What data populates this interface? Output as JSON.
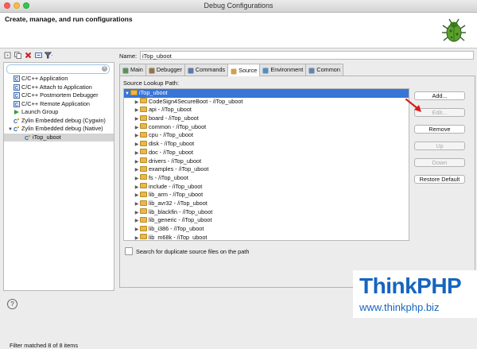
{
  "window": {
    "title": "Debug Configurations"
  },
  "header": {
    "title": "Create, manage, and run configurations"
  },
  "toolbar": {
    "icons": [
      "new-launch-config-icon",
      "duplicate-icon",
      "delete-icon",
      "collapse-all-icon",
      "filter-icon"
    ]
  },
  "left": {
    "filter_placeholder": "",
    "items": [
      {
        "label": "C/C++ Application",
        "icon": "c-app-icon",
        "level": 1
      },
      {
        "label": "C/C++ Attach to Application",
        "icon": "c-attach-icon",
        "level": 1
      },
      {
        "label": "C/C++ Postmortem Debugger",
        "icon": "c-postmortem-icon",
        "level": 1
      },
      {
        "label": "C/C++ Remote Application",
        "icon": "c-remote-icon",
        "level": 1
      },
      {
        "label": "Launch Group",
        "icon": "launch-group-icon",
        "level": 1
      },
      {
        "label": "Zylin Embedded debug (Cygwin)",
        "icon": "zylin-icon",
        "level": 1
      },
      {
        "label": "Zylin Embedded debug (Native)",
        "icon": "zylin-icon",
        "level": 1,
        "expanded": true
      },
      {
        "label": "iTop_uboot",
        "icon": "zylin-config-icon",
        "level": 2,
        "selected": true
      }
    ],
    "status": "Filter matched 8 of 8 items"
  },
  "right": {
    "name_label": "Name:",
    "name_value": "iTop_uboot",
    "tabs": [
      {
        "label": "Main",
        "icon": "main-tab-icon"
      },
      {
        "label": "Debugger",
        "icon": "debugger-tab-icon"
      },
      {
        "label": "Commands",
        "icon": "commands-tab-icon"
      },
      {
        "label": "Source",
        "icon": "source-tab-icon",
        "active": true
      },
      {
        "label": "Environment",
        "icon": "environment-tab-icon"
      },
      {
        "label": "Common",
        "icon": "common-tab-icon"
      }
    ],
    "source_label": "Source Lookup Path:",
    "source_root": "iTop_uboot",
    "source_items": [
      "CodeSign4SecureBoot - /iTop_uboot",
      "api - /iTop_uboot",
      "board - /iTop_uboot",
      "common - /iTop_uboot",
      "cpu - /iTop_uboot",
      "disk - /iTop_uboot",
      "doc - /iTop_uboot",
      "drivers - /iTop_uboot",
      "examples - /iTop_uboot",
      "fs - /iTop_uboot",
      "include - /iTop_uboot",
      "lib_arm - /iTop_uboot",
      "lib_avr32 - /iTop_uboot",
      "lib_blackfin - /iTop_uboot",
      "lib_generic - /iTop_uboot",
      "lib_i386 - /iTop_uboot",
      "lib_m68k - /iTop_uboot"
    ],
    "buttons": [
      {
        "label": "Add...",
        "enabled": true
      },
      {
        "label": "Edit...",
        "enabled": false
      },
      {
        "label": "Remove",
        "enabled": true
      },
      {
        "label": "Up",
        "enabled": false
      },
      {
        "label": "Down",
        "enabled": false
      },
      {
        "label": "Restore Default",
        "enabled": true
      }
    ],
    "checkbox_label": "Search for duplicate source files on the path",
    "checkbox_checked": false
  },
  "watermark": {
    "brand": "ThinkPHP",
    "url": "www.thinkphp.biz"
  },
  "colors": {
    "selection": "#3875d7",
    "folder": "#e8b84a",
    "brand": "#1565c0",
    "arrow": "#d81b1b"
  }
}
